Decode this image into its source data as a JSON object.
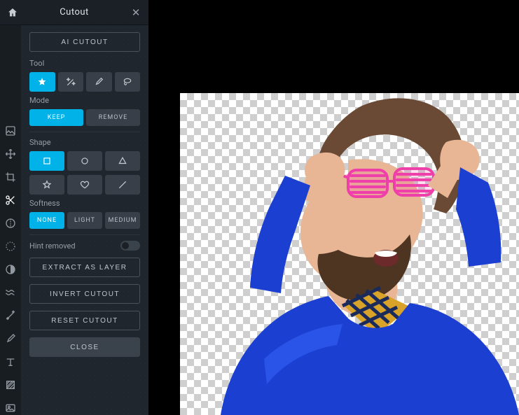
{
  "header": {
    "title": "Cutout",
    "home_icon": "home-icon",
    "close_icon": "close-icon"
  },
  "left_icons": [
    {
      "name": "image-icon"
    },
    {
      "name": "arrows-move-icon"
    },
    {
      "name": "crop-icon"
    },
    {
      "name": "scissors-icon",
      "active": true
    },
    {
      "name": "adjust-icon"
    },
    {
      "name": "dotted-circle-icon"
    },
    {
      "name": "contrast-icon"
    },
    {
      "name": "waves-icon"
    },
    {
      "name": "magic-wand-icon"
    },
    {
      "name": "brush-icon"
    },
    {
      "name": "text-icon"
    },
    {
      "name": "hatch-square-icon"
    },
    {
      "name": "picture-icon"
    }
  ],
  "buttons": {
    "ai_cutout": "AI CUTOUT",
    "extract_layer": "EXTRACT AS LAYER",
    "invert": "INVERT CUTOUT",
    "reset": "RESET CUTOUT",
    "close": "CLOSE"
  },
  "sections": {
    "tool_label": "Tool",
    "tool_icons": [
      "star-icon",
      "wand-icon",
      "brush-icon",
      "lasso-icon"
    ],
    "mode_label": "Mode",
    "mode": {
      "keep": "KEEP",
      "remove": "REMOVE",
      "active": "keep"
    },
    "shape_label": "Shape",
    "shape_row1": [
      "square-icon",
      "circle-icon",
      "triangle-icon"
    ],
    "shape_row2": [
      "star-outline-icon",
      "heart-icon",
      "line-icon"
    ],
    "softness_label": "Softness",
    "softness": {
      "none": "NONE",
      "light": "LIGHT",
      "medium": "MEDIUM",
      "active": "none"
    },
    "hint_label": "Hint removed",
    "hint_state": false
  },
  "colors": {
    "accent": "#00b2e8",
    "panel": "#20262d",
    "btn": "#383f48"
  },
  "canvas": {
    "subject": "man-with-pink-glasses",
    "background": "transparent-checker"
  }
}
